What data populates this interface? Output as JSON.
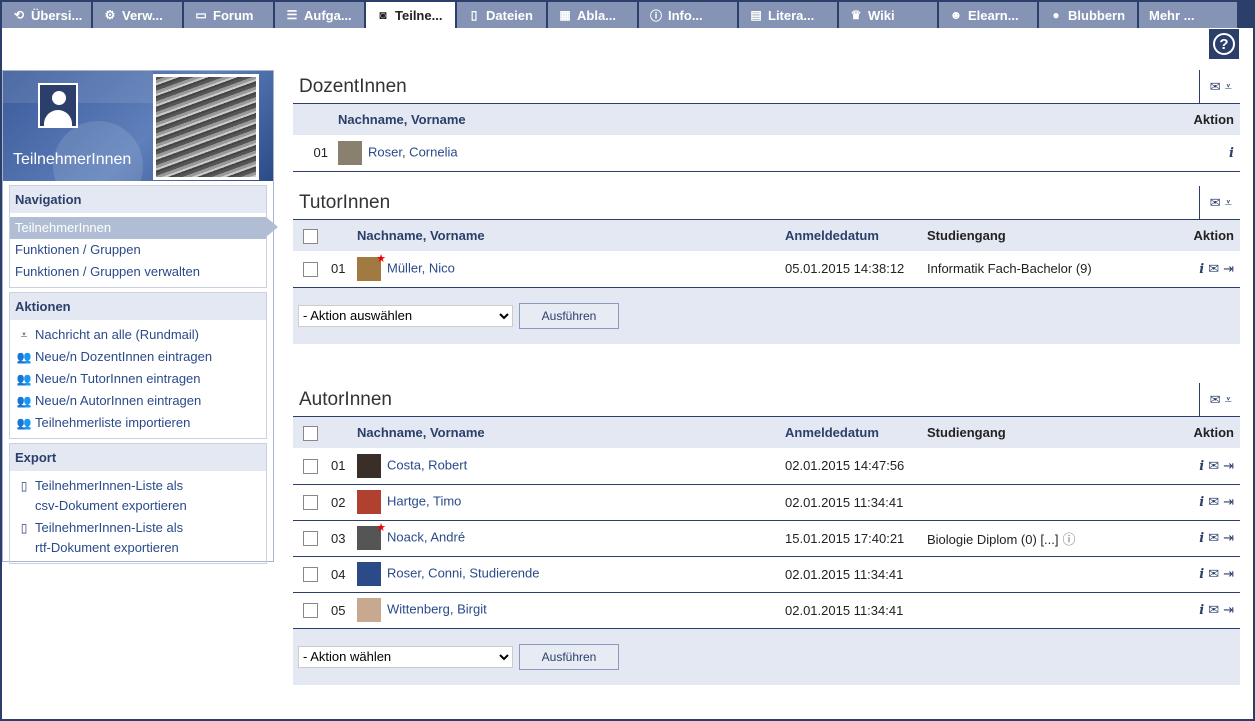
{
  "tabs": [
    {
      "icon": "overview-icon",
      "glyph": "⟲",
      "label": "Übersi..."
    },
    {
      "icon": "gear-icon",
      "glyph": "⚙",
      "label": "Verw..."
    },
    {
      "icon": "forum-icon",
      "glyph": "▭",
      "label": "Forum"
    },
    {
      "icon": "tasks-icon",
      "glyph": "☰",
      "label": "Aufga..."
    },
    {
      "icon": "participants-icon",
      "glyph": "◙",
      "label": "Teilne...",
      "active": true
    },
    {
      "icon": "files-icon",
      "glyph": "▯",
      "label": "Dateien"
    },
    {
      "icon": "schedule-icon",
      "glyph": "▦",
      "label": "Abla..."
    },
    {
      "icon": "info-icon",
      "glyph": "ⓘ",
      "label": "Info..."
    },
    {
      "icon": "literature-icon",
      "glyph": "▤",
      "label": "Litera..."
    },
    {
      "icon": "wiki-icon",
      "glyph": "♛",
      "label": "Wiki"
    },
    {
      "icon": "elearning-icon",
      "glyph": "☻",
      "label": "Elearn..."
    },
    {
      "icon": "blubbern-icon",
      "glyph": "●",
      "label": "Blubbern"
    },
    {
      "icon": "more-icon",
      "glyph": "",
      "label": "Mehr ..."
    }
  ],
  "sidebar": {
    "title": "TeilnehmerInnen",
    "navigation": {
      "title": "Navigation",
      "items": [
        "TeilnehmerInnen",
        "Funktionen / Gruppen",
        "Funktionen / Gruppen verwalten"
      ]
    },
    "actions": {
      "title": "Aktionen",
      "items": [
        {
          "icon": "mail-all-icon",
          "label": "Nachricht an alle (Rundmail)"
        },
        {
          "icon": "add-users-icon",
          "label": "Neue/n DozentInnen eintragen"
        },
        {
          "icon": "add-users-icon",
          "label": "Neue/n TutorInnen eintragen"
        },
        {
          "icon": "add-users-icon",
          "label": "Neue/n AutorInnen eintragen"
        },
        {
          "icon": "add-users-icon",
          "label": "Teilnehmerliste importieren"
        }
      ]
    },
    "export": {
      "title": "Export",
      "items": [
        {
          "label1": "TeilnehmerInnen-Liste als",
          "label2": "csv-Dokument exportieren"
        },
        {
          "label1": "TeilnehmerInnen-Liste als",
          "label2": "rtf-Dokument exportieren"
        }
      ]
    }
  },
  "dozenten": {
    "title": "DozentInnen",
    "col_name": "Nachname, Vorname",
    "col_action": "Aktion",
    "rows": [
      {
        "num": "01",
        "name": "Roser, Cornelia",
        "avatar": "#8a8070"
      }
    ]
  },
  "tutoren": {
    "title": "TutorInnen",
    "col_name": "Nachname, Vorname",
    "col_date": "Anmeldedatum",
    "col_study": "Studiengang",
    "col_action": "Aktion",
    "rows": [
      {
        "num": "01",
        "name": "Müller, Nico",
        "date": "05.01.2015 14:38:12",
        "study": "Informatik Fach-Bachelor (9)",
        "avatar": "#a07a40",
        "star": true
      }
    ],
    "select": "- Aktion auswählen",
    "button": "Ausführen"
  },
  "autoren": {
    "title": "AutorInnen",
    "col_name": "Nachname, Vorname",
    "col_date": "Anmeldedatum",
    "col_study": "Studiengang",
    "col_action": "Aktion",
    "rows": [
      {
        "num": "01",
        "name": "Costa, Robert",
        "date": "02.01.2015 14:47:56",
        "study": "",
        "avatar": "#3a2e28",
        "star": false
      },
      {
        "num": "02",
        "name": "Hartge, Timo",
        "date": "02.01.2015 11:34:41",
        "study": "",
        "avatar": "#b04030",
        "star": false
      },
      {
        "num": "03",
        "name": "Noack, André",
        "date": "15.01.2015 17:40:21",
        "study": "Biologie Diplom (0) [...]",
        "avatar": "#555555",
        "star": true
      },
      {
        "num": "04",
        "name": "Roser, Conni, Studierende",
        "date": "02.01.2015 11:34:41",
        "study": "",
        "avatar": "#2b4a88",
        "star": false
      },
      {
        "num": "05",
        "name": "Wittenberg, Birgit",
        "date": "02.01.2015 11:34:41",
        "study": "",
        "avatar": "#c9a890",
        "star": false
      }
    ],
    "select": "- Aktion wählen",
    "button": "Ausführen"
  }
}
